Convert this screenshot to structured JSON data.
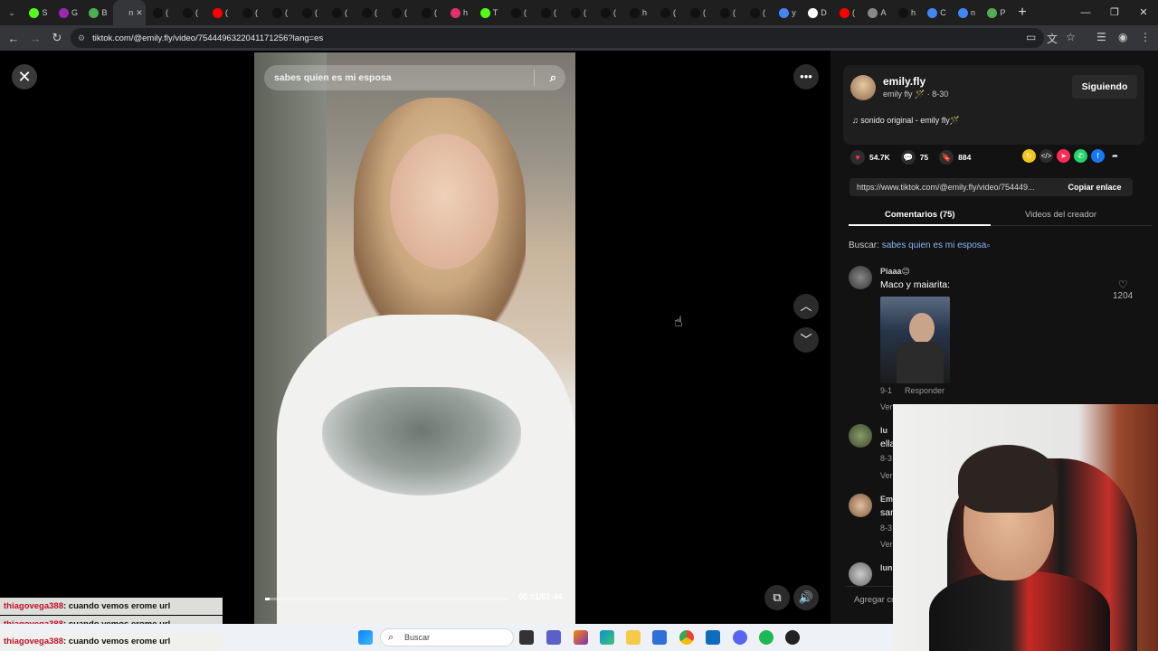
{
  "browser": {
    "tabs": [
      {
        "letter": "S",
        "color": "#53fc18"
      },
      {
        "letter": "G",
        "color": "#9c27b0"
      },
      {
        "letter": "B",
        "color": "#4caf50"
      },
      {
        "letter": "n",
        "color": "#35363a",
        "active": true
      },
      {
        "letter": "(",
        "color": "#111"
      },
      {
        "letter": "(",
        "color": "#111"
      },
      {
        "letter": "(",
        "color": "#ff0000"
      },
      {
        "letter": "(",
        "color": "#111"
      },
      {
        "letter": "(",
        "color": "#111"
      },
      {
        "letter": "(",
        "color": "#111"
      },
      {
        "letter": "(",
        "color": "#111"
      },
      {
        "letter": "(",
        "color": "#111"
      },
      {
        "letter": "(",
        "color": "#111"
      },
      {
        "letter": "(",
        "color": "#111"
      },
      {
        "letter": "h",
        "color": "#e1306c"
      },
      {
        "letter": "T",
        "color": "#53fc18"
      },
      {
        "letter": "(",
        "color": "#111"
      },
      {
        "letter": "(",
        "color": "#111"
      },
      {
        "letter": "(",
        "color": "#111"
      },
      {
        "letter": "(",
        "color": "#111"
      },
      {
        "letter": "h",
        "color": "#111"
      },
      {
        "letter": "(",
        "color": "#111"
      },
      {
        "letter": "(",
        "color": "#111"
      },
      {
        "letter": "(",
        "color": "#111"
      },
      {
        "letter": "(",
        "color": "#111"
      },
      {
        "letter": "y",
        "color": "#4285f4"
      },
      {
        "letter": "D",
        "color": "#fff"
      },
      {
        "letter": "(",
        "color": "#ff0000"
      },
      {
        "letter": "A",
        "color": "#888"
      },
      {
        "letter": "h",
        "color": "#111"
      },
      {
        "letter": "C",
        "color": "#4285f4"
      },
      {
        "letter": "n",
        "color": "#4285f4"
      },
      {
        "letter": "P",
        "color": "#4caf50"
      }
    ],
    "url": "tiktok.com/@emily.fly/video/7544496322041171256?lang=es"
  },
  "video": {
    "search_text": "sabes quien es mi esposa",
    "timecode": "00:01/02:44",
    "progress_fraction": 0.02
  },
  "creator": {
    "name": "emily.fly",
    "subline": "emily fly 🪄 · 8-30",
    "follow_label": "Siguiendo",
    "sound": "sonido original - emily fly🪄"
  },
  "stats": {
    "likes": "54.7K",
    "comments": "75",
    "saves": "884"
  },
  "link": {
    "url": "https://www.tiktok.com/@emily.fly/video/754449...",
    "copy_label": "Copiar enlace"
  },
  "tabs": {
    "comments": "Comentarios (75)",
    "creator_videos": "Videos del creador"
  },
  "search_suggest": {
    "prefix": "Buscar: ",
    "query": "sabes quien es mi esposa"
  },
  "comments": [
    {
      "user": "Piaaa😉",
      "text": "Maco y maiarita:",
      "date": "9-1",
      "reply": "Responder",
      "likes": "1204",
      "more": "Ver"
    },
    {
      "user": "lu",
      "text": "ella",
      "date": "8-3",
      "more": "Ver"
    },
    {
      "user": "Em",
      "text": "san",
      "date": "8-3",
      "more": "Ver"
    },
    {
      "user": "lun",
      "text": "",
      "date": "",
      "more": ""
    }
  ],
  "add_comment": "Agregar co",
  "chat": [
    {
      "user": "thiagovega388",
      "msg": ": cuando vemos erome url"
    },
    {
      "user": "thiagovega388",
      "msg": ": cuando vemos erome url"
    },
    {
      "user": "thiagovega388",
      "msg": ": cuando vemos erome url"
    }
  ],
  "taskbar": {
    "search_placeholder": "Buscar"
  }
}
